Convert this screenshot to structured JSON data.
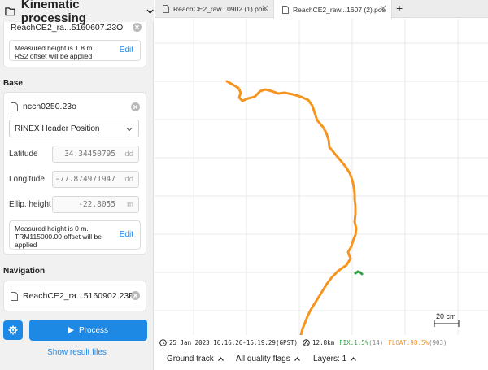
{
  "app": {
    "title": "Kinematic processing"
  },
  "rover": {
    "file_name": "ReachCE2_ra...5160607.23O",
    "note": "Measured height is 1.8 m. RS2 offset will be applied",
    "note_line1": "Measured height is 1.8 m.",
    "note_line2": "RS2 offset will be applied",
    "edit_label": "Edit"
  },
  "base": {
    "section_label": "Base",
    "file_name": "ncch0250.23o",
    "position_source": "RINEX Header Position",
    "latitude_label": "Latitude",
    "latitude_value": "34.34450795",
    "latitude_unit": "dd",
    "longitude_label": "Longitude",
    "longitude_value": "-77.874971947",
    "longitude_unit": "dd",
    "height_label": "Ellip. height",
    "height_value": "-22.8055",
    "height_unit": "m",
    "note_line1": "Measured height is 0 m.",
    "note_line2": "TRM115000.00 offset will be",
    "note_line3": "applied",
    "edit_label": "Edit"
  },
  "navigation": {
    "section_label": "Navigation",
    "file_name": "ReachCE2_ra...5160902.23P"
  },
  "actions": {
    "process_label": "Process",
    "show_results_label": "Show result files"
  },
  "tabs": [
    {
      "label": "ReachCE2_raw...0902 (1).pos"
    },
    {
      "label": "ReachCE2_raw...1607 (2).pos"
    }
  ],
  "map": {
    "scale_label": "20 cm"
  },
  "status": {
    "date_range": "25 Jan 2023 16:16:26-16:19:29(GPST)",
    "distance": "12.8km",
    "fix_label": "FIX:1.5%",
    "fix_count": "(14)",
    "float_label": "FLOAT:98.5%",
    "float_count": "(903)"
  },
  "bottom": {
    "view_mode": "Ground track",
    "quality_filter": "All quality flags",
    "layers": "Layers: 1"
  },
  "colors": {
    "accent": "#1e88e5",
    "float": "#f7941d",
    "fix": "#2ea043"
  }
}
